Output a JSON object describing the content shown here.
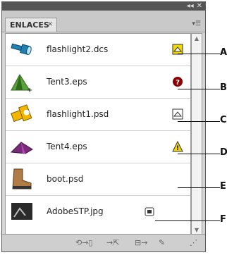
{
  "window": {
    "collapse_label": "◂◂",
    "close_label": "✕"
  },
  "panel": {
    "tab_label": "ENLACES",
    "tab_close": "✕",
    "menu_label": "▾☰"
  },
  "links": [
    {
      "name": "flashlight2.dcs",
      "thumb": "flashlight-icon",
      "status": "modified-icon"
    },
    {
      "name": "Tent3.eps",
      "thumb": "tent-icon",
      "status": "missing-icon"
    },
    {
      "name": "flashlight1.psd",
      "thumb": "flashlight-icon",
      "status": "modified-icon"
    },
    {
      "name": "Tent4.eps",
      "thumb": "tent-icon",
      "status": "warning-icon"
    },
    {
      "name": "boot.psd",
      "thumb": "boot-icon",
      "status": ""
    },
    {
      "name": "AdobeSTP.jpg",
      "thumb": "image-icon",
      "status": "embedded-icon"
    }
  ],
  "callouts": [
    "A",
    "B",
    "C",
    "D",
    "E",
    "F"
  ],
  "colors": {
    "highlight": "#e6c700",
    "error": "#8b0000",
    "warning": "#e8c200"
  }
}
